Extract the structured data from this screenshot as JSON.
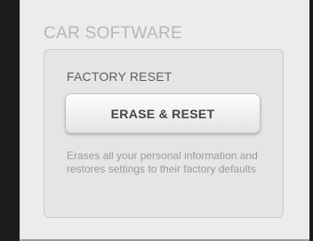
{
  "section": {
    "title": "CAR SOFTWARE"
  },
  "factory_reset": {
    "title": "FACTORY RESET",
    "button_label": "ERASE & RESET",
    "description": "Erases all your personal information and restores settings to their factory defaults"
  }
}
